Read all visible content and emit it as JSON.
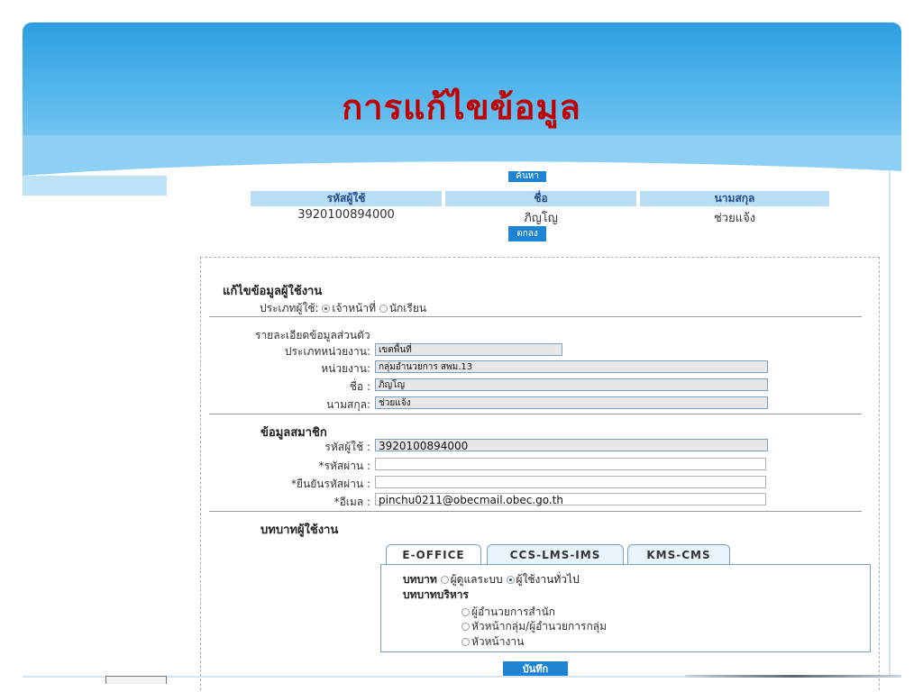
{
  "slide": {
    "title": "การแก้ไขข้อมูล"
  },
  "search": {
    "button_label": "ค้นหา",
    "columns": [
      "รหัสผู้ใช้",
      "ชื่อ",
      "นามสกุล"
    ],
    "row": {
      "user_id": "3920100894000",
      "first_name": "ภิญโญ",
      "last_name": "ช่วยแจ้ง"
    },
    "ok_label": "ตกลง"
  },
  "form": {
    "heading": "แก้ไขข้อมูลผู้ใช้งาน",
    "user_type": {
      "label": "ประเภทผู้ใช้:",
      "options": [
        "เจ้าหน้าที่",
        "นักเรียน"
      ],
      "selected": "เจ้าหน้าที่"
    },
    "personal": {
      "heading": "รายละเอียดข้อมูลส่วนตัว",
      "unit_type_label": "ประเภทหน่วยงาน:",
      "unit_type_value": "เขตพื้นที่",
      "unit_label": "หน่วยงาน:",
      "unit_value": "กลุ่มอำนวยการ สพม.13",
      "name_label": "ชื่อ :",
      "name_value": "ภิญโญ",
      "surname_label": "นามสกุล:",
      "surname_value": "ช่วยแจ้ง"
    },
    "member": {
      "heading": "ข้อมูลสมาชิก",
      "user_id_label": "รหัสผู้ใช้ :",
      "user_id_value": "3920100894000",
      "password_label": "*รหัสผ่าน :",
      "password_value": "",
      "confirm_label": "*ยืนยันรหัสผ่าน :",
      "confirm_value": "",
      "email_label": "*อีเมล :",
      "email_value": "pinchu0211@obecmail.obec.go.th"
    },
    "roles": {
      "heading": "บทบาทผู้ใช้งาน",
      "tabs": [
        "E-OFFICE",
        "CCS-LMS-IMS",
        "KMS-CMS"
      ],
      "active_tab": "E-OFFICE",
      "role_label": "บทบาท",
      "role_options": [
        "ผู้ดูแลระบบ",
        "ผู้ใช้งานทั่วไป"
      ],
      "role_selected": "ผู้ใช้งานทั่วไป",
      "admin_role_label": "บทบาทบริหาร",
      "admin_options": [
        "ผู้อำนวยการสำนัก",
        "หัวหน้ากลุ่ม/ผู้อำนวยการกลุ่ม",
        "หัวหน้างาน"
      ]
    },
    "save_label": "บันทึก"
  },
  "colors": {
    "banner": "#2c9ee0",
    "title": "#c00000",
    "button": "#1d83d2",
    "header_cell": "#b8def6"
  }
}
